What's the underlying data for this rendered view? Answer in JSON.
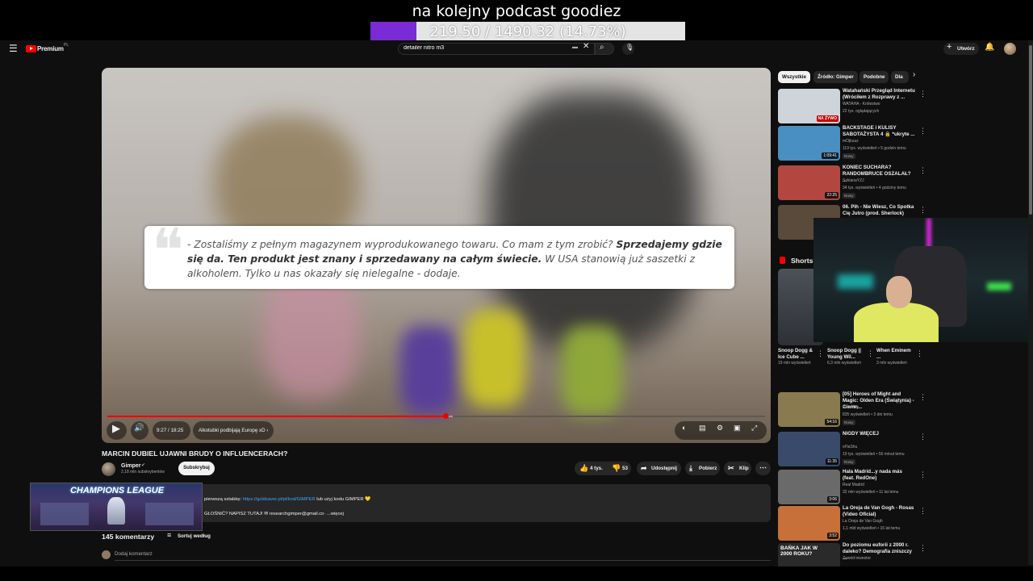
{
  "stream_goal": {
    "title": "na kolejny podcast goodiez",
    "progress_text": "219.50 / 1490.32 (14.73%)",
    "percent": 14.73,
    "fill_color": "#7a2bd6"
  },
  "masthead": {
    "logo": "Premium",
    "logo_sup": "PL",
    "search_value": "detailer nitro m3",
    "create_label": "Utwórz",
    "icons": [
      "menu-icon",
      "search-icon",
      "mic-icon",
      "bell-icon",
      "keyboard-icon",
      "clear-icon"
    ]
  },
  "player": {
    "quote": {
      "p1": "- Zostaliśmy z pełnym magazynem wyprodukowanego towaru. Co mam z tym zrobić? ",
      "b1": "Sprzedajemy gdzie się da. Ten produkt jest znany i sprzedawany na całym świecie.",
      "p2": " W USA                         stanowią już saszetki z alkoholem. Tylko u nas okazały się nielegalne - dodaje."
    },
    "time": "9:27 / 18:25",
    "chapter": "Alkotubki podbijają Europę xD",
    "progress_percent": 51.4,
    "buffer_percent": 52.5,
    "accent": "#ff0000"
  },
  "video": {
    "title": "MARCIN DUBIEL UJAWNI BRUDY O INFLUENCERACH?",
    "channel": "Gimper",
    "subscribers": "2,18 mln subskrybentów",
    "subscribe": "Subskrybuj",
    "likes": "4 tys.",
    "dislikes": "53",
    "share": "Udostępnij",
    "download": "Pobierz",
    "clip": "Klip"
  },
  "description": {
    "line1_prefix": "pierwszą sztabkę: ",
    "line1_link": "https://goldsaver.pl/pl/kod/GIMPER",
    "line1_suffix": " lub użyj kodu GIMPER 💛",
    "line2": "GŁOŚNIĆ? NAPISZ TUTAJ! ✉ researchgimper@gmail.co·  ...więcej"
  },
  "champions_overlay": "CHAMPIONS LEAGUE",
  "comments": {
    "count": "145 komentarzy",
    "sort": "Sortuj według",
    "add": "Dodaj komentarz"
  },
  "chips": [
    "Wszystkie",
    "Źródło: Gimper",
    "Podobne",
    "Dla"
  ],
  "recommended_top": [
    {
      "title": "Watahański Przegląd Internetu (Wróciłem z Rozprawy z ...",
      "channel": "WATAHA - Królestwo",
      "meta": "22 tys. oglądających",
      "badge": "NA ŻYWO",
      "thumb": "#cfd4da"
    },
    {
      "title": "BACKSTAGE i KULISY SABOTAŻYSTA 4 🔒 *ukryte ...",
      "channel": "mOjkuuz",
      "meta": "119 tys. wyświetleń • 5 godzin temu",
      "badge": "Nowy",
      "duration": "1:09:41",
      "thumb": "#4a8fc2"
    },
    {
      "title": "KONIEC SUCHARA? RANDOMBRUCE OSZALAŁ? ...",
      "channel": "SzklanaYZJ",
      "meta": "34 tys. wyświetleń • 4 godziny temu",
      "badge": "Nowy",
      "duration": "22:25",
      "thumb": "#b3473f"
    },
    {
      "title": "06. Pih - Nie Wiesz, Co Spotka Cię Jutro (prod. Sherlock)",
      "channel": "",
      "meta": "",
      "thumb": "#5a4a3a"
    }
  ],
  "shorts": {
    "label": "Shorts",
    "items": [
      {
        "title": "Snoop Dogg & Ice Cube ...",
        "meta": "19 mln wyświetleń"
      },
      {
        "title": "Snoop Dogg || Young Wil...",
        "meta": "6,3 mln wyświetleń"
      },
      {
        "title": "When Eminem ...",
        "meta": "3 mln wyświetleń"
      }
    ]
  },
  "recommended_bottom": [
    {
      "title": "[05] Heroes of Might and Magic: Olden Era (Świątynia) - Ciemn...",
      "channel": "Piotr40ry",
      "meta": "835 wyświetleń • 3 dni temu",
      "badge": "Nowy",
      "duration": "54:16",
      "thumb": "#8a7a50"
    },
    {
      "title": "NIGDY WIĘCEJ",
      "channel": "xFlaShu",
      "meta": "19 tys. wyświetleń • 56 minut temu",
      "badge": "Nowy",
      "duration": "11:35",
      "thumb": "#3a4a6a"
    },
    {
      "title": "Hala Madrid...y nada más (feat. RedOne)",
      "channel": "Real Madrid",
      "meta": "32 mln wyświetleń • 11 lat temu",
      "duration": "3:06",
      "thumb": "#6a6a6a"
    },
    {
      "title": "La Oreja de Van Gogh - Rosas (Video Oficial)",
      "channel": "La Oreja de Van Gogh",
      "meta": "1,1 mld wyświetleń • 16 lat temu",
      "duration": "3:52",
      "thumb": "#c7703a"
    },
    {
      "title": "Do poziomu euforii z 2000 r. daleko? Demografia zniszczy ...",
      "channel": "Zawód inwestor",
      "meta": "",
      "thumb": "#2a2a2a",
      "overlay": "BAŃKA JAK W 2000 ROKU?"
    }
  ]
}
